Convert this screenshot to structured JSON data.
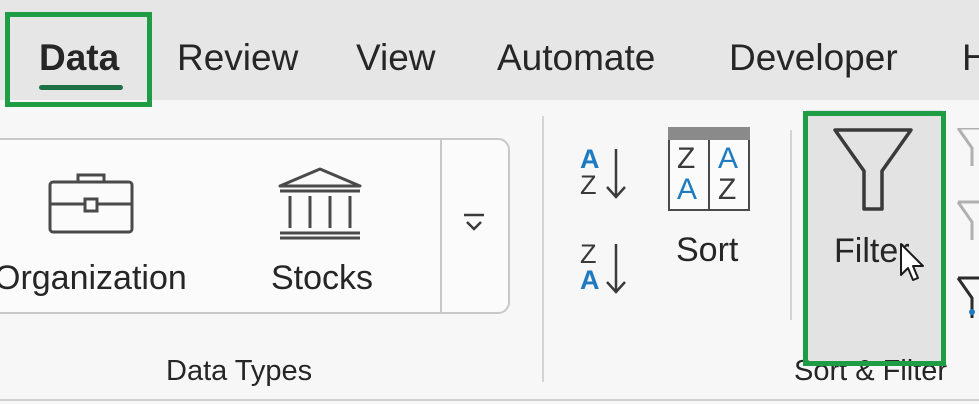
{
  "tabs": [
    {
      "label": "Data",
      "active": true
    },
    {
      "label": "Review"
    },
    {
      "label": "View"
    },
    {
      "label": "Automate"
    },
    {
      "label": "Developer"
    },
    {
      "label": "H"
    }
  ],
  "data_types": {
    "group_label": "Data Types",
    "items": [
      {
        "label": "Organization",
        "icon": "briefcase-icon"
      },
      {
        "label": "Stocks",
        "icon": "bank-icon"
      }
    ],
    "more_icon": "gallery-more-icon"
  },
  "sort_filter": {
    "group_label": "Sort & Filter",
    "sort_az": {
      "top": "A",
      "bottom": "Z"
    },
    "sort_za": {
      "top": "Z",
      "bottom": "A"
    },
    "sort_dialog_icon": {
      "cells": [
        "Z",
        "A",
        "A",
        "Z"
      ]
    },
    "sort_label": "Sort",
    "filter_label": "Filter"
  },
  "colors": {
    "highlight": "#1f9d44",
    "accent_blue": "#1f7bc1",
    "tab_underline": "#1e7145"
  }
}
